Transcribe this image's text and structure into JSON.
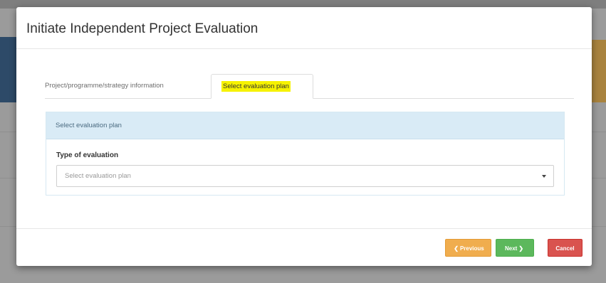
{
  "modal": {
    "title": "Initiate Independent Project Evaluation"
  },
  "tabs": [
    {
      "label": "Project/programme/strategy information",
      "active": false
    },
    {
      "label": "Select evaluation plan",
      "active": true,
      "highlight_color": "#f6f200"
    }
  ],
  "panel": {
    "heading": "Select evaluation plan",
    "heading_bg": "#d9ebf6",
    "field_label": "Type of evaluation",
    "select": {
      "placeholder": "Select evaluation plan",
      "icon": "caret-down-icon"
    }
  },
  "footer": {
    "previous": {
      "label": "Previous",
      "icon": "circle-arrow-left-icon",
      "color": "#f0ad4e"
    },
    "next": {
      "label": "Next",
      "icon": "circle-arrow-right-icon",
      "color": "#5cb85c"
    },
    "cancel": {
      "label": "Cancel",
      "color": "#d9534f"
    }
  }
}
